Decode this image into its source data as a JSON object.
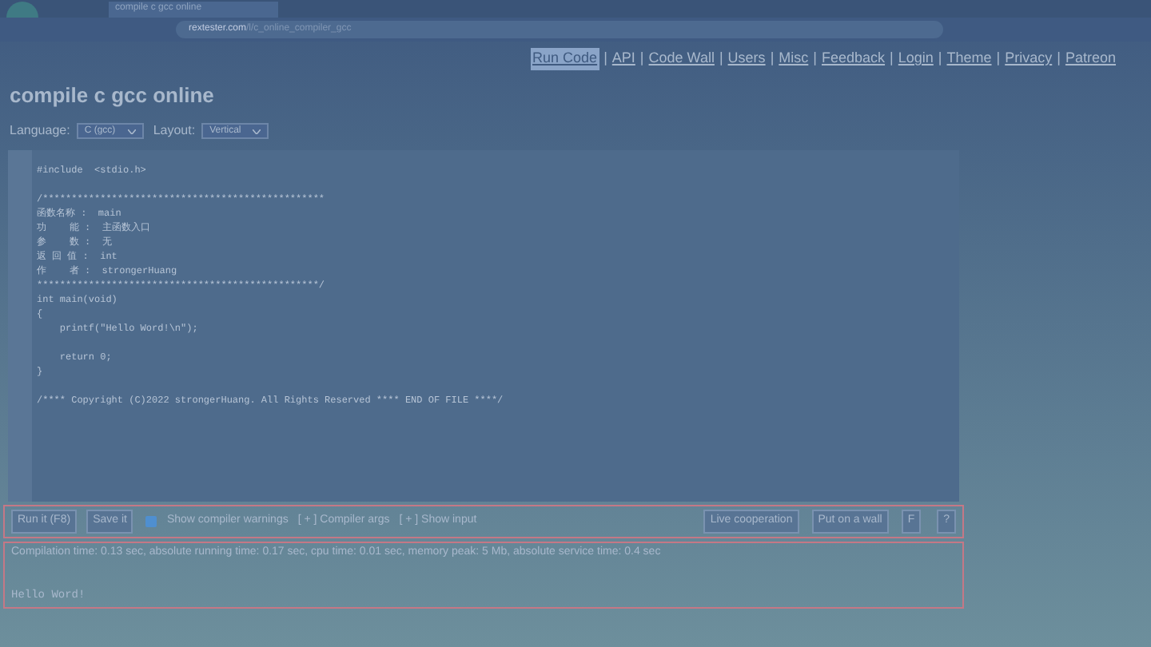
{
  "browser": {
    "tab_title": "compile c gcc online",
    "url_host": "rextester.com",
    "url_path": "/l/c_online_compiler_gcc"
  },
  "nav": [
    {
      "label": "Run Code",
      "selected": true
    },
    {
      "separator": "|",
      "label": "API",
      "selected": false
    },
    {
      "separator": "|",
      "label": "Code Wall",
      "selected": false
    },
    {
      "separator": "|",
      "label": "Users",
      "selected": false
    },
    {
      "separator": "|",
      "label": "Misc",
      "selected": false
    },
    {
      "separator": "|",
      "label": "Feedback",
      "selected": false
    },
    {
      "separator": "|",
      "label": "Login",
      "selected": false
    },
    {
      "separator": "|",
      "label": "Theme",
      "selected": false
    },
    {
      "separator": "|",
      "label": "Privacy",
      "selected": false
    },
    {
      "separator": "|",
      "label": "Patreon",
      "selected": false
    }
  ],
  "title": "compile c gcc online",
  "options": [
    {
      "label": "Language:",
      "value": "C (gcc)"
    },
    {
      "label": "Layout:",
      "value": "Vertical"
    }
  ],
  "code_lines": [
    {
      "kind": "code",
      "text": "#include  <stdio.h>"
    },
    {
      "kind": "blank"
    },
    {
      "kind": "code",
      "text": "/*************************************************"
    },
    {
      "kind": "code",
      "text": "函数名称 :  main"
    },
    {
      "kind": "code",
      "text": "功    能 :  主函数入口"
    },
    {
      "kind": "code",
      "text": "参    数 :  无"
    },
    {
      "kind": "code",
      "text": "返 回 值 :  int"
    },
    {
      "kind": "code",
      "text": "作    者 :  strongerHuang"
    },
    {
      "kind": "code",
      "text": "*************************************************/"
    },
    {
      "kind": "code",
      "text": "int main(void)"
    },
    {
      "kind": "code",
      "text": "{"
    },
    {
      "kind": "code",
      "text": "    printf(\"Hello Word!\\n\");"
    },
    {
      "kind": "blank"
    },
    {
      "kind": "code",
      "text": "    return 0;"
    },
    {
      "kind": "code",
      "text": "}"
    },
    {
      "kind": "blank"
    },
    {
      "kind": "code",
      "text": "/**** Copyright (C)2022 strongerHuang. All Rights Reserved **** END OF FILE ****/"
    }
  ],
  "toolbar": {
    "run": "Run it (F8)",
    "save": "Save it",
    "warnings": {
      "label": "Show compiler warnings",
      "checked": true
    },
    "args": "[ + ] Compiler args",
    "input": "[ + ] Show input",
    "live": "Live cooperation",
    "wall": "Put on a wall",
    "f": "F",
    "help": "?"
  },
  "output": {
    "stats": "Compilation time: 0.13 sec, absolute running time: 0.17 sec, cpu time: 0.01 sec, memory peak: 5 Mb, absolute service time: 0.4 sec",
    "result": "Hello Word!"
  }
}
